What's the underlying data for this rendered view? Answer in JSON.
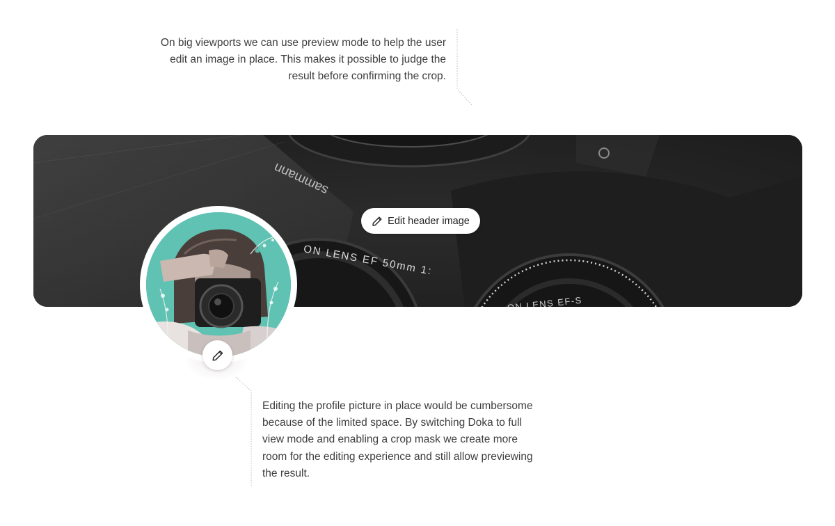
{
  "annotations": {
    "top_note": "On big viewports we can use preview mode to help the user edit an image in place. This makes it possible to judge the result before confirming the crop.",
    "bottom_note": "Editing the profile picture in place would be cumbersome because of the limited space. By switching Doka to full view mode and enabling a crop mask we create more room for the editing experience and still allow previewing the result."
  },
  "header": {
    "edit_button_label": "Edit header image",
    "edit_button_icon": "pencil-icon",
    "image_lettering": {
      "lens_left": "ON  LENS  EF  50mm  1:",
      "lens_right": "ON  LENS  EF-S",
      "brand_mirror": "sammann"
    }
  },
  "profile": {
    "edit_button_icon": "pencil-icon"
  },
  "colors": {
    "header_bg": "#262626",
    "avatar_accent": "#5fc2b2",
    "text": "#3d3d3d",
    "leader_line": "#b9b9b9"
  }
}
